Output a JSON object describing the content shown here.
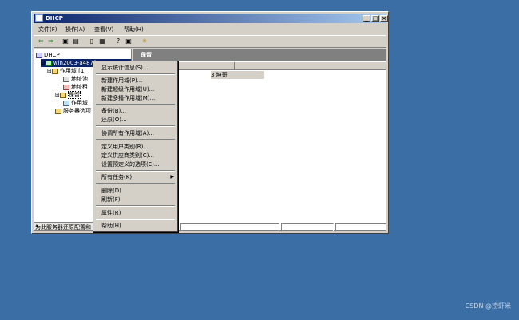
{
  "window": {
    "title": "DHCP",
    "min": "_",
    "max": "□",
    "close": "×"
  },
  "menubar": [
    "文件(F)",
    "操作(A)",
    "查看(V)",
    "帮助(H)"
  ],
  "tree": {
    "root": "DHCP",
    "server": "win2003-a487f",
    "scope": "作用域 [1",
    "children": [
      "地址池",
      "地址租",
      "保留",
      "作用域"
    ],
    "server_options": "服务器选项"
  },
  "right_pane": {
    "title": "保留",
    "cell": "3 坤哥"
  },
  "context_menu": {
    "groups": [
      [
        "显示统计信息(S)..."
      ],
      [
        "新建作用域(P)...",
        "新建超级作用域(U)...",
        "新建多播作用域(M)..."
      ],
      [
        "备份(B)...",
        "还原(O)..."
      ],
      [
        "协调所有作用域(A)..."
      ],
      [
        "定义用户类别(R)...",
        "定义供应商类别(C)...",
        "设置预定义的选项(E)..."
      ],
      [
        "所有任务(K)"
      ],
      [
        "删除(D)",
        "刷新(F)"
      ],
      [
        "属性(R)"
      ],
      [
        "帮助(H)"
      ]
    ]
  },
  "statusbar": {
    "text": "为此服务器还原配置和"
  },
  "watermark": "CSDN @捞虾米"
}
